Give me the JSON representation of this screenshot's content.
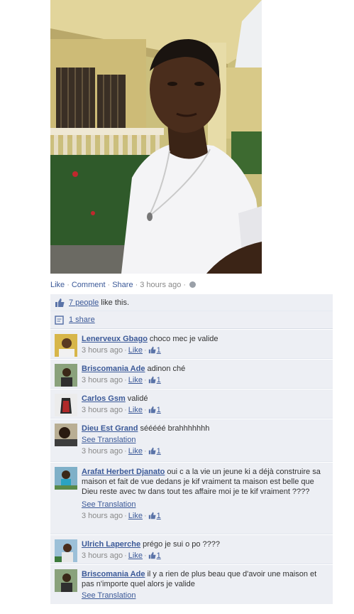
{
  "post": {
    "actions": {
      "like": "Like",
      "comment": "Comment",
      "share": "Share",
      "time": "3 hours ago"
    },
    "likes": {
      "people_link": "7 people",
      "suffix": " like this."
    },
    "shares": {
      "label": "1 share"
    }
  },
  "comments": [
    {
      "name": "Lenerveux Gbago",
      "text": "choco mec je valide",
      "time": "3 hours ago",
      "like": "Like",
      "likes": "1",
      "translation": ""
    },
    {
      "name": "Briscomania Ade",
      "text": "adinon ché",
      "time": "3 hours ago",
      "like": "Like",
      "likes": "1",
      "translation": ""
    },
    {
      "name": "Carlos Gsm",
      "text": "validé",
      "time": "3 hours ago",
      "like": "Like",
      "likes": "1",
      "translation": ""
    },
    {
      "name": "Dieu Est Grand",
      "text": "sééééé brahhhhhhh",
      "time": "3 hours ago",
      "like": "Like",
      "likes": "1",
      "translation": "See Translation"
    },
    {
      "name": "Arafat Herbert Djanato",
      "text": "oui c a la vie un jeune ki a déjà construire sa maison et fait de vue dedans je kif vraiment ta maison est belle que Dieu reste avec tw dans tout tes affaire moi je te kif vraiment ????",
      "time": "3 hours ago",
      "like": "Like",
      "likes": "1",
      "translation": "See Translation"
    },
    {
      "name": "Ulrich Laperche",
      "text": "prégo je sui o po ????",
      "time": "3 hours ago",
      "like": "Like",
      "likes": "1",
      "translation": ""
    },
    {
      "name": "Briscomania Ade",
      "text": "il y a rien de plus beau que d'avoir une maison et pas n'importe quel alors je valide",
      "time": "",
      "like": "",
      "likes": "",
      "translation": "See Translation"
    }
  ],
  "icons": {
    "like": "thumbs-up-icon",
    "share": "share-icon",
    "privacy": "globe-icon"
  },
  "colors": {
    "link": "#3b5998",
    "ufi_bg": "#edeff4",
    "meta": "#888888"
  }
}
